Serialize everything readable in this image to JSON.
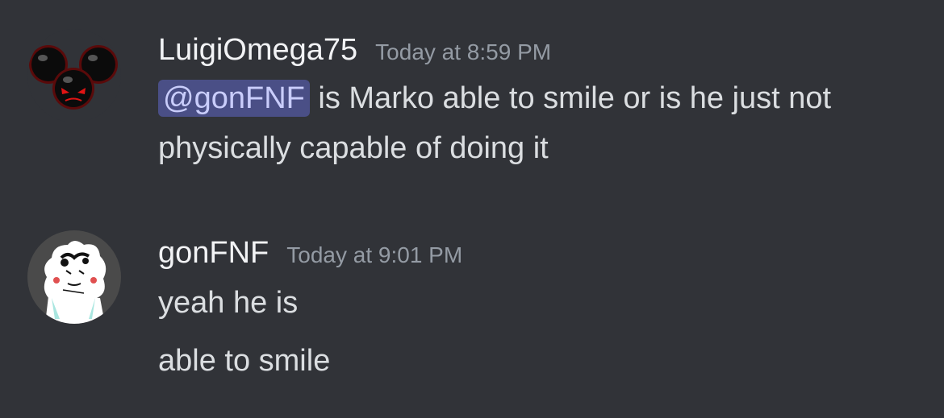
{
  "messages": [
    {
      "username": "LuigiOmega75",
      "timestamp": "Today at 8:59 PM",
      "avatar_icon": "dark-spheres-avatar",
      "mention": "@gonFNF",
      "line1_rest": " is Marko able to smile or is he just not",
      "line2": "physically capable of doing it"
    },
    {
      "username": "gonFNF",
      "timestamp": "Today at 9:01 PM",
      "avatar_icon": "sketch-character-avatar",
      "line1": "yeah he is",
      "line2": "able to smile"
    }
  ],
  "colors": {
    "background": "#313338",
    "username": "#f2f3f5",
    "timestamp": "#949ba4",
    "text": "#dbdee1",
    "mention_bg": "#4a4f86",
    "mention_text": "#c9cdfb"
  }
}
